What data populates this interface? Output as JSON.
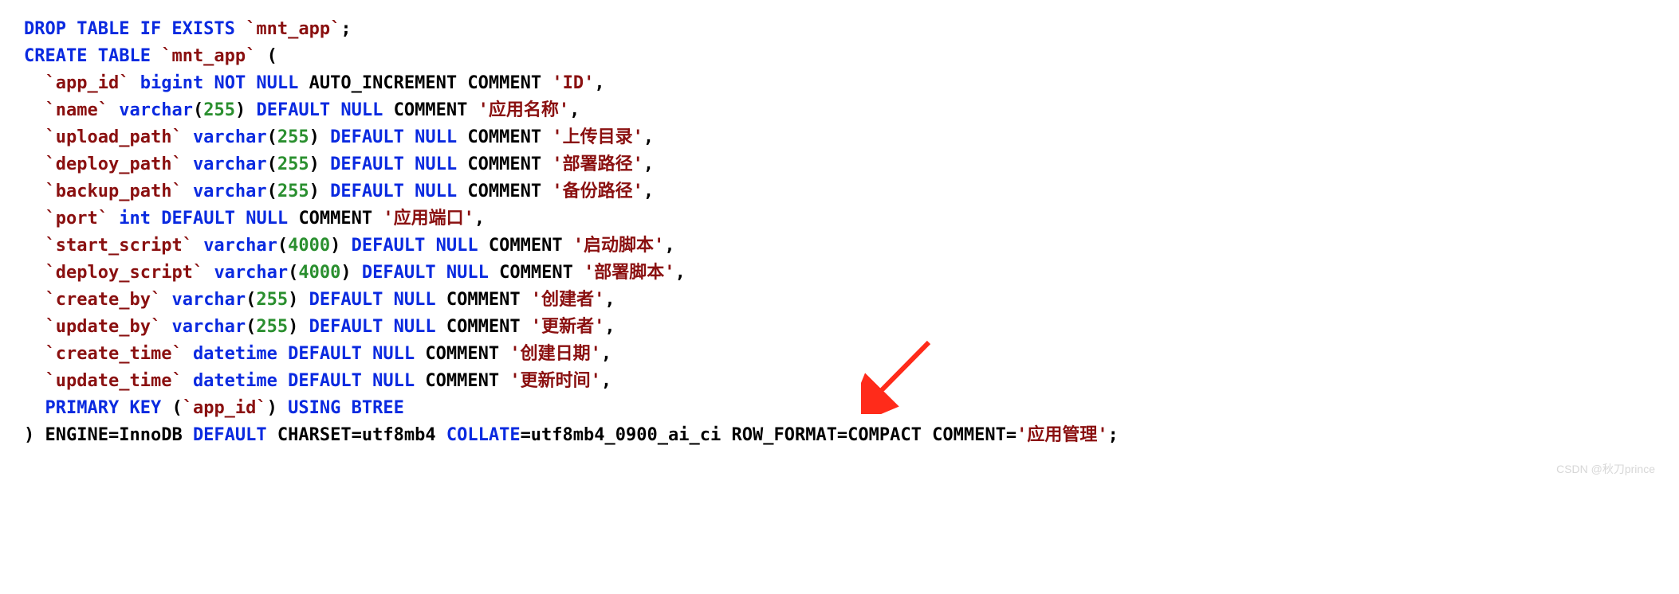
{
  "sql": {
    "drop": {
      "kw": "DROP TABLE IF EXISTS",
      "tbl": "`mnt_app`",
      "semi": ";"
    },
    "create": {
      "kw": "CREATE TABLE",
      "tbl": "`mnt_app`",
      "open": " ("
    },
    "cols": [
      {
        "name": "`app_id`",
        "type": "bigint",
        "mods": "NOT NULL",
        "extra": "AUTO_INCREMENT COMMENT",
        "str": "'ID'",
        "end": ","
      },
      {
        "name": "`name`",
        "type": "varchar",
        "len": "255",
        "mods": "DEFAULT NULL",
        "extra": "COMMENT",
        "str": "'应用名称'",
        "end": ","
      },
      {
        "name": "`upload_path`",
        "type": "varchar",
        "len": "255",
        "mods": "DEFAULT NULL",
        "extra": "COMMENT",
        "str": "'上传目录'",
        "end": ","
      },
      {
        "name": "`deploy_path`",
        "type": "varchar",
        "len": "255",
        "mods": "DEFAULT NULL",
        "extra": "COMMENT",
        "str": "'部署路径'",
        "end": ","
      },
      {
        "name": "`backup_path`",
        "type": "varchar",
        "len": "255",
        "mods": "DEFAULT NULL",
        "extra": "COMMENT",
        "str": "'备份路径'",
        "end": ","
      },
      {
        "name": "`port`",
        "type": "int",
        "mods": "DEFAULT NULL",
        "extra": "COMMENT",
        "str": "'应用端口'",
        "end": ","
      },
      {
        "name": "`start_script`",
        "type": "varchar",
        "len": "4000",
        "mods": "DEFAULT NULL",
        "extra": "COMMENT",
        "str": "'启动脚本'",
        "end": ","
      },
      {
        "name": "`deploy_script`",
        "type": "varchar",
        "len": "4000",
        "mods": "DEFAULT NULL",
        "extra": "COMMENT",
        "str": "'部署脚本'",
        "end": ","
      },
      {
        "name": "`create_by`",
        "type": "varchar",
        "len": "255",
        "mods": "DEFAULT NULL",
        "extra": "COMMENT",
        "str": "'创建者'",
        "end": ","
      },
      {
        "name": "`update_by`",
        "type": "varchar",
        "len": "255",
        "mods": "DEFAULT NULL",
        "extra": "COMMENT",
        "str": "'更新者'",
        "end": ","
      },
      {
        "name": "`create_time`",
        "type": "datetime",
        "mods": "DEFAULT NULL",
        "extra": "COMMENT",
        "str": "'创建日期'",
        "end": ","
      },
      {
        "name": "`update_time`",
        "type": "datetime",
        "mods": "DEFAULT NULL",
        "extra": "COMMENT",
        "str": "'更新时间'",
        "end": ","
      }
    ],
    "pk": {
      "kw1": "PRIMARY KEY",
      "open": "(",
      "col": "`app_id`",
      "close": ")",
      "kw2": "USING BTREE"
    },
    "tail": {
      "close": ")",
      "engine_lbl": "ENGINE=InnoDB",
      "default_kw": "DEFAULT",
      "charset": "CHARSET=utf8mb4",
      "collate_kw": "COLLATE",
      "collate_val": "=utf8mb4_0900_ai_ci",
      "rowfmt": "ROW_FORMAT=COMPACT",
      "comment_kw": "COMMENT=",
      "comment_str": "'应用管理'",
      "semi": ";"
    }
  },
  "watermark": "CSDN @秋刀prince",
  "colors": {
    "keyword": "#0a2ae0",
    "identifier": "#8a1010",
    "number": "#2a8f2f",
    "string": "#8a1010",
    "arrow": "#ff2b1a"
  }
}
